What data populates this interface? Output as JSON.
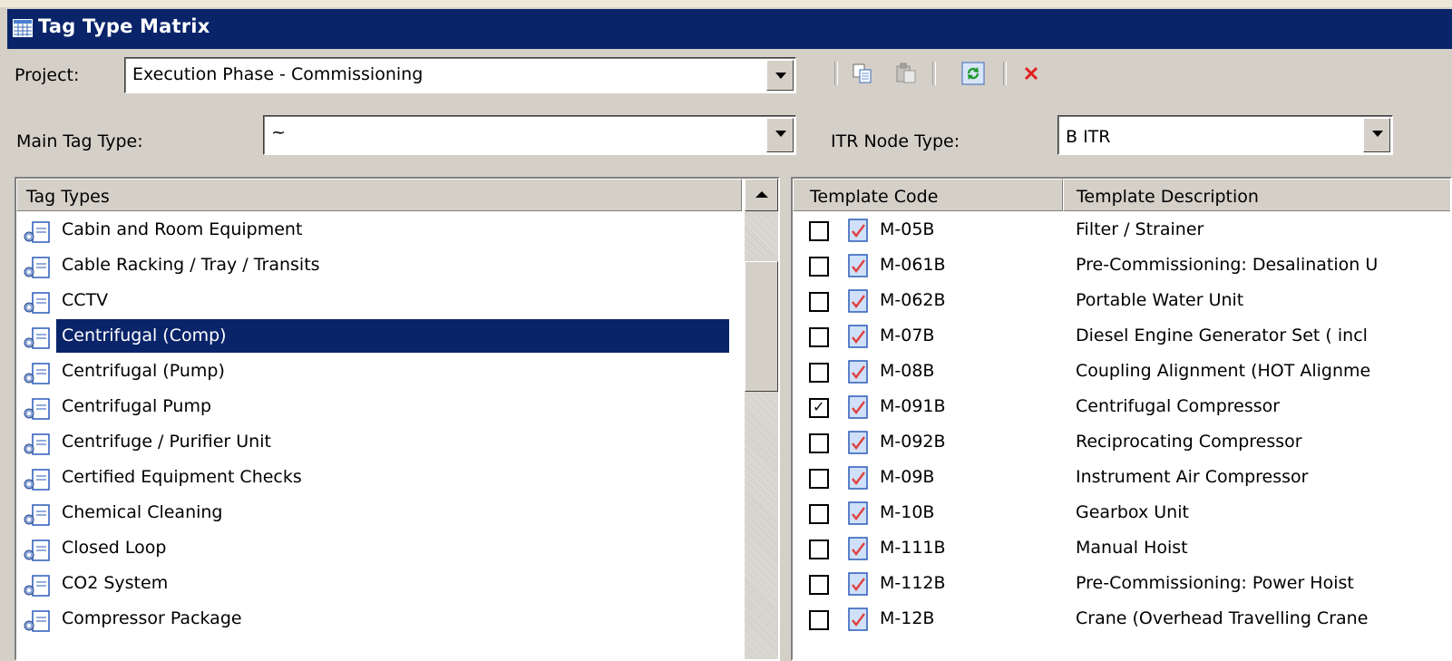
{
  "window": {
    "title": "Tag Type Matrix",
    "icon": "grid-icon",
    "title_color": "#0a246a"
  },
  "project": {
    "label": "Project:",
    "value": "Execution Phase - Commissioning"
  },
  "toolbar": {
    "icons": [
      "copy-icon",
      "paste-icon",
      "refresh-icon",
      "delete-icon"
    ]
  },
  "main_tag_type": {
    "label": "Main Tag Type:",
    "value": "~"
  },
  "itr_node_type": {
    "label": "ITR Node Type:",
    "value": "B ITR"
  },
  "tag_types": {
    "header": "Tag Types",
    "items": [
      "Cabin and Room Equipment",
      "Cable Racking / Tray / Transits",
      "CCTV",
      "Centrifugal (Comp)",
      "Centrifugal (Pump)",
      "Centrifugal Pump",
      "Centrifuge / Purifier Unit",
      "Certified Equipment Checks",
      "Chemical Cleaning",
      "Closed Loop",
      "CO2 System",
      "Compressor Package"
    ],
    "selected": "Centrifugal (Comp)",
    "selection_color": "#0a246a"
  },
  "templates": {
    "headers": [
      "Template Code",
      "Template Description"
    ],
    "rows": [
      {
        "code": "M-05B",
        "desc": "Filter / Strainer",
        "checked": false
      },
      {
        "code": "M-061B",
        "desc": "Pre-Commissioning: Desalination U",
        "checked": false
      },
      {
        "code": "M-062B",
        "desc": "Portable Water Unit",
        "checked": false
      },
      {
        "code": "M-07B",
        "desc": "Diesel Engine Generator Set ( incl",
        "checked": false
      },
      {
        "code": "M-08B",
        "desc": "Coupling Alignment (HOT Alignme",
        "checked": false
      },
      {
        "code": "M-091B",
        "desc": "Centrifugal Compressor",
        "checked": true
      },
      {
        "code": "M-092B",
        "desc": "Reciprocating Compressor",
        "checked": false
      },
      {
        "code": "M-09B",
        "desc": "Instrument Air Compressor",
        "checked": false
      },
      {
        "code": "M-10B",
        "desc": "Gearbox Unit",
        "checked": false
      },
      {
        "code": "M-111B",
        "desc": "Manual Hoist",
        "checked": false
      },
      {
        "code": "M-112B",
        "desc": "Pre-Commissioning: Power Hoist",
        "checked": false
      },
      {
        "code": "M-12B",
        "desc": "Crane (Overhead Travelling Crane",
        "checked": false
      }
    ]
  }
}
